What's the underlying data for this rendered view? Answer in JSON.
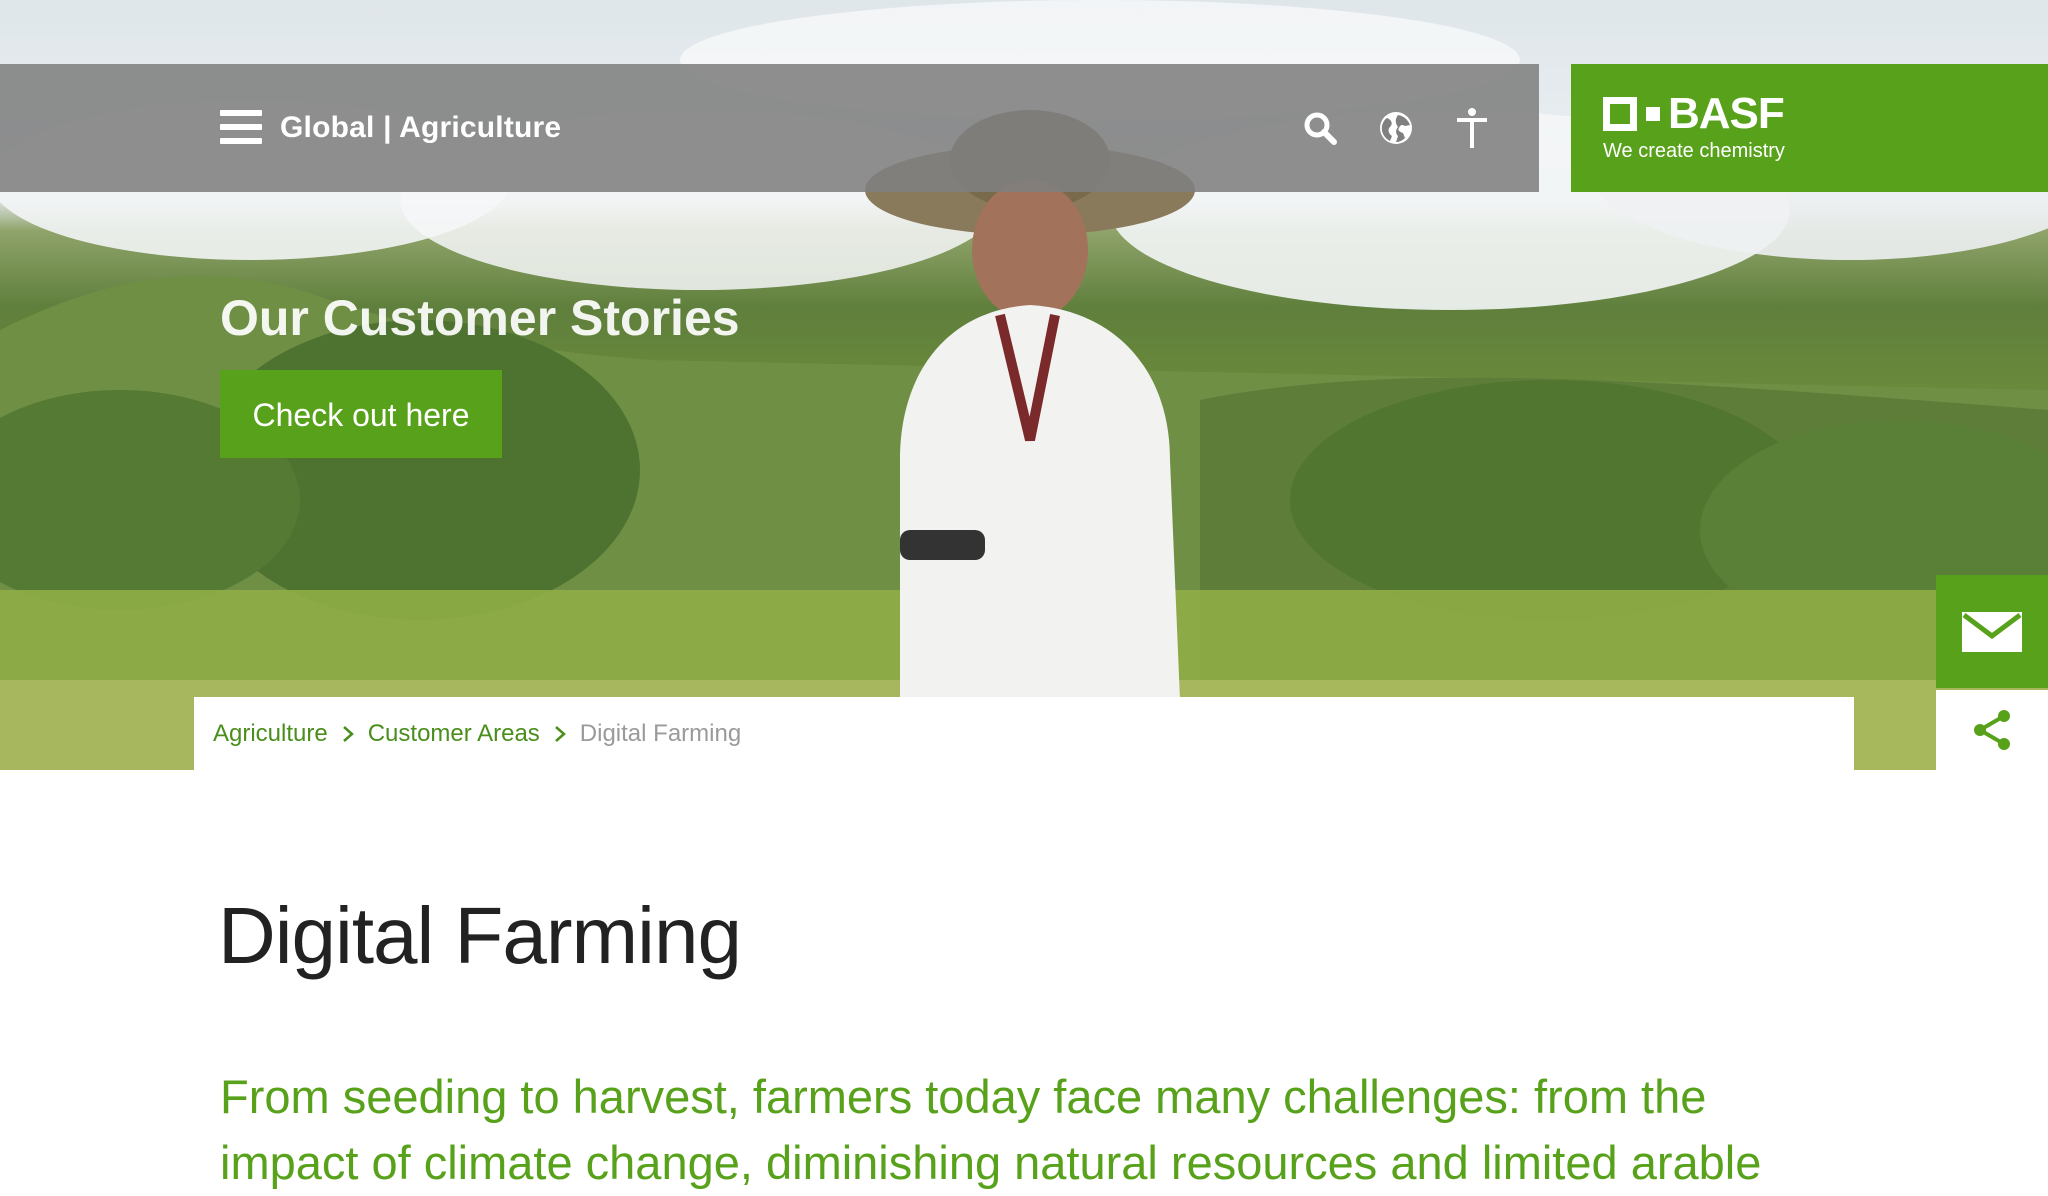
{
  "header": {
    "site_title": "Global | Agriculture",
    "icons": [
      "menu-icon",
      "search-icon",
      "globe-icon",
      "accessibility-icon"
    ]
  },
  "logo": {
    "name": "BASF",
    "tagline": "We create chemistry"
  },
  "hero": {
    "heading": "Our Customer Stories",
    "cta_label": "Check out here"
  },
  "side_actions": {
    "icons": [
      "mail-icon",
      "share-icon"
    ]
  },
  "breadcrumb": {
    "items": [
      "Agriculture",
      "Customer Areas",
      "Digital Farming"
    ]
  },
  "main": {
    "title": "Digital Farming",
    "intro": "From seeding to harvest, farmers today face many challenges: from the impact of climate change, diminishing natural resources and limited arable"
  },
  "colors": {
    "brand_green": "#58a21b",
    "link_green": "#4a8e1c",
    "nav_gray": "#808080"
  }
}
